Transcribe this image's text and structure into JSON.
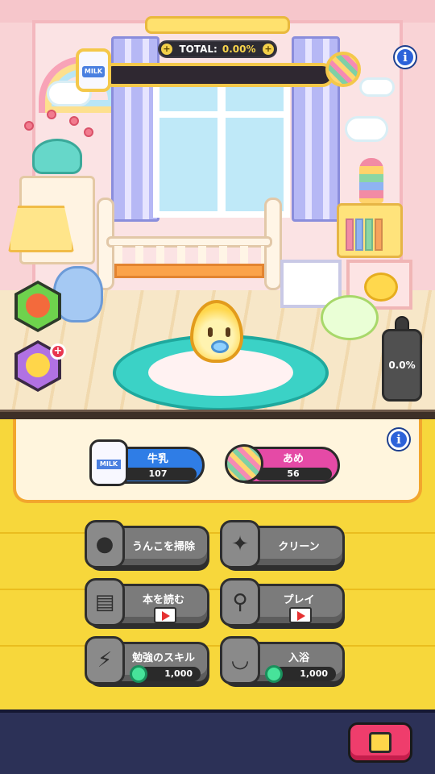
{
  "hud": {
    "total_label": "TOTAL:",
    "total_value": "0.00%",
    "milk_icon_text": "MILK",
    "bottle_value": "0.0%",
    "info_symbol": "i",
    "plus_symbol": "+",
    "progress_fraction": 0.0
  },
  "resources": {
    "milk": {
      "label": "牛乳",
      "count": "107",
      "icon": "milk-carton-icon",
      "color": "#2f7de6"
    },
    "candy": {
      "label": "あめ",
      "count": "56",
      "icon": "candy-icon",
      "color": "#e54aa6"
    }
  },
  "actions": [
    {
      "id": "clean-poop",
      "label": "うんこを掃除",
      "icon": "poop-icon"
    },
    {
      "id": "clean",
      "label": "クリーン",
      "icon": "broom-icon"
    },
    {
      "id": "read-book",
      "label": "本を読む",
      "icon": "book-icon",
      "video": true
    },
    {
      "id": "play",
      "label": "プレイ",
      "icon": "rattle-icon",
      "video": true
    },
    {
      "id": "study-skill",
      "label": "勉強のスキル",
      "icon": "study-icon",
      "cost": "1,000"
    },
    {
      "id": "bath",
      "label": "入浴",
      "icon": "bathtub-icon",
      "cost": "1,000"
    }
  ],
  "side_buttons": [
    {
      "id": "food",
      "icon": "beans-icon",
      "color": "#6ed24d"
    },
    {
      "id": "pet",
      "icon": "pet-icon",
      "color": "#b171e3"
    }
  ],
  "exit_icon": "exit-door-icon"
}
